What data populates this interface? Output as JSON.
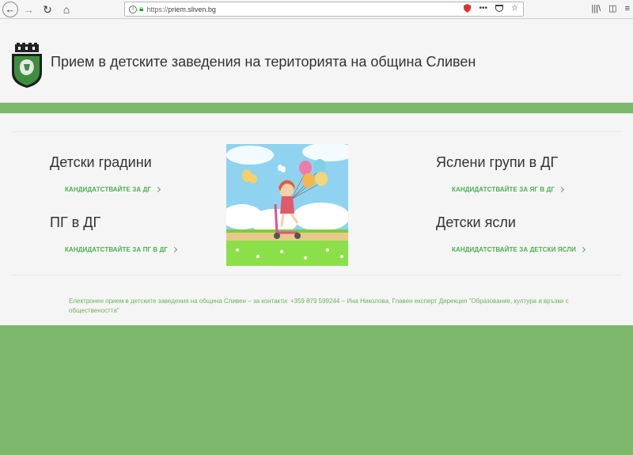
{
  "browser": {
    "url_scheme": "https://",
    "url_host": "priem.sliven.bg",
    "menu_dots": "•••"
  },
  "header": {
    "title": "Прием в детските заведения на територията на община Сливен"
  },
  "categories": [
    {
      "title": "Детски градини",
      "link": "КАНДИДАТСТВАЙТЕ ЗА ДГ"
    },
    {
      "title": "ПГ в ДГ",
      "link": "КАНДИДАТСТВАЙТЕ ЗА ПГ В ДГ"
    },
    {
      "title": "Яслени групи в ДГ",
      "link": "КАНДИДАТСТВАЙТЕ ЗА ЯГ В ДГ"
    },
    {
      "title": "Детски ясли",
      "link": "КАНДИДАТСТВАЙТЕ ЗА ДЕТСКИ ЯСЛИ"
    }
  ],
  "footer": {
    "text": "Електронен прием в детските заведения на община Сливен – за контакти: +359 879 599244 – Ина Николова, Главен експерт Дирекция \"Образование, култура и връзки с обществеността\""
  },
  "colors": {
    "accent": "#4caf50",
    "page_bg": "#7db86c",
    "panel_bg": "#f5f5f5"
  }
}
